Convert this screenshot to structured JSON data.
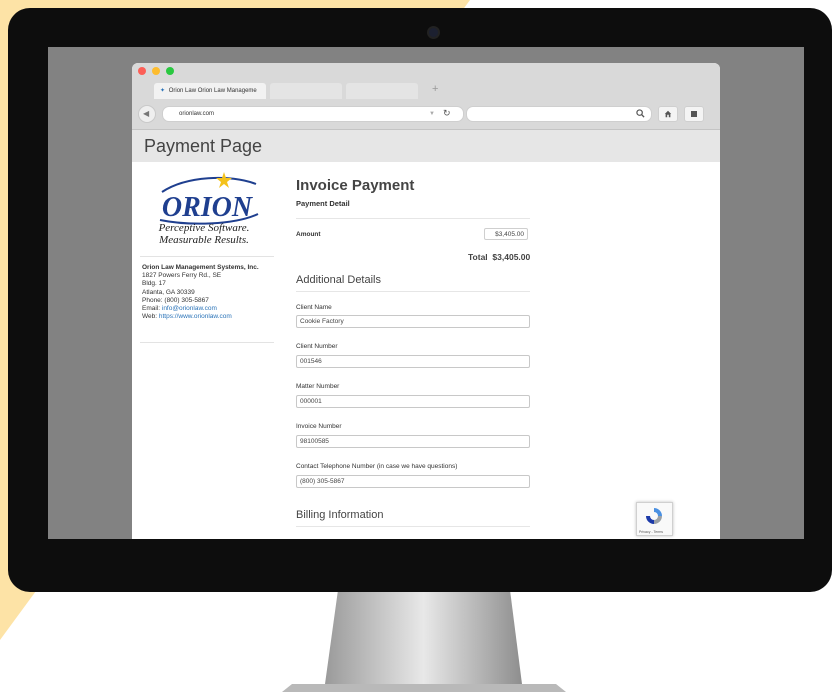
{
  "colors": {
    "accent_wedge": "#fde3a6",
    "monitor_bezel": "#0d0d0d",
    "link": "#2a73b8",
    "logo_blue": "#1f3f8f",
    "logo_star": "#f4c21b"
  },
  "browser": {
    "tabs": [
      "Orion Law Orion Law Manageme",
      "",
      ""
    ],
    "new_tab": "+",
    "url": "orionlaw.com",
    "reload_icon": "reload-icon",
    "search_icon": "search-icon",
    "home_icon": "home-icon",
    "menu_icon": "menu-icon"
  },
  "page": {
    "title": "Payment Page"
  },
  "sidebar": {
    "logo_word": "ORION",
    "tagline_1": "Perceptive Software.",
    "tagline_2": "Measurable Results.",
    "company": "Orion Law Management Systems, Inc.",
    "address_1": "1827 Powers Ferry Rd., SE",
    "address_2": "Bldg. 17",
    "address_3": "Atlanta, GA 30339",
    "phone": "Phone: (800) 305-5867",
    "email_label": "Email: ",
    "email": "info@orionlaw.com",
    "web_label": "Web: ",
    "web": "https://www.orionlaw.com"
  },
  "invoice": {
    "heading": "Invoice Payment",
    "subheading": "Payment Detail",
    "amount_label": "Amount",
    "amount_value": "$3,405.00",
    "total_label": "Total",
    "total_value": "$3,405.00"
  },
  "additional": {
    "heading": "Additional Details",
    "client_name_label": "Client Name",
    "client_name": "Cookie Factory",
    "client_number_label": "Client Number",
    "client_number": "001546",
    "matter_number_label": "Matter Number",
    "matter_number": "000001",
    "invoice_number_label": "Invoice Number",
    "invoice_number": "98100585",
    "phone_label": "Contact Telephone Number (in case we have questions)",
    "phone": "(800) 305-5867"
  },
  "billing": {
    "heading": "Billing Information"
  },
  "recaptcha": {
    "text": "Privacy - Terms"
  }
}
